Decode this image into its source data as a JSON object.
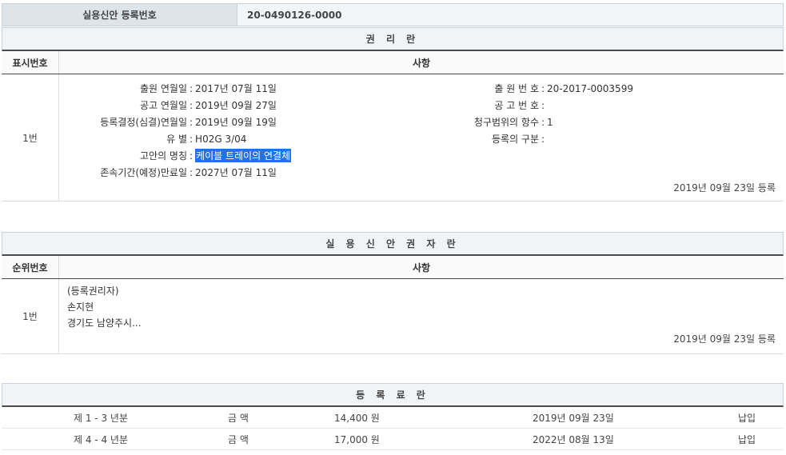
{
  "registration": {
    "label": "실용신안 등록번호",
    "number": "20-0490126-0000"
  },
  "rights": {
    "title": "권 리 란",
    "col_num": "표시번호",
    "col_item": "사항",
    "row_num": "1번",
    "left": [
      {
        "k": "출원 연월일",
        "v": "2017년 07월 11일"
      },
      {
        "k": "공고 연월일",
        "v": "2019년 09월 27일"
      },
      {
        "k": "등록결정(심결)연월일",
        "v": "2019년 09월 19일"
      },
      {
        "k": "유 별",
        "v": "H02G 3/04"
      },
      {
        "k": "고안의 명칭",
        "v": "케이블 트레이의 연결체"
      },
      {
        "k": "존속기간(예정)만료일",
        "v": "2027년 07월 11일"
      }
    ],
    "right": [
      {
        "k": "출 원 번 호",
        "v": "20-2017-0003599"
      },
      {
        "k": "공 고 번 호",
        "v": ""
      },
      {
        "k": "청구범위의 항수",
        "v": "1"
      },
      {
        "k": "등록의 구분",
        "v": ""
      }
    ],
    "reg_date": "2019년 09월 23일 등록"
  },
  "owners": {
    "title": "실 용 신 안 권 자 란",
    "col_num": "순위번호",
    "col_item": "사항",
    "row_num": "1번",
    "type": "(등록권리자)",
    "name": "손지현",
    "address": "경기도 남양주시...",
    "reg_date": "2019년 09월 23일 등록"
  },
  "fees": {
    "title": "등 록 료 란",
    "rows": [
      {
        "period": "제 1 - 3 년분",
        "amount_label": "금 액",
        "amount": "14,400 원",
        "date": "2019년 09월 23일",
        "status": "납입"
      },
      {
        "period": "제 4 - 4 년분",
        "amount_label": "금 액",
        "amount": "17,000 원",
        "date": "2022년 08월 13일",
        "status": "납입"
      }
    ]
  }
}
